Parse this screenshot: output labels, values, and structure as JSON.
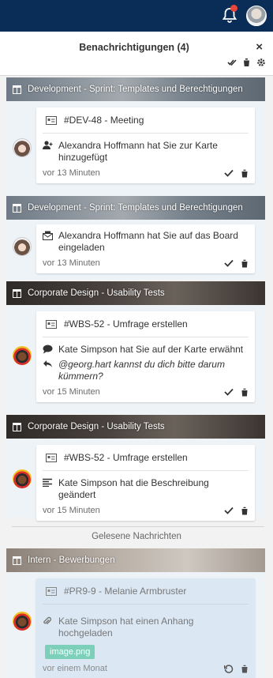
{
  "panel": {
    "title": "Benachrichtigungen (4)",
    "close": "×"
  },
  "groups": [
    {
      "board": "Development - Sprint: Templates und Berechtigungen",
      "card_title": "#DEV-48 - Meeting",
      "message": "Alexandra Hoffmann hat Sie zur Karte hinzugefügt",
      "time": "vor 13 Minuten"
    },
    {
      "board": "Development - Sprint: Templates und Berechtigungen",
      "message": "Alexandra Hoffmann hat Sie auf das Board eingeladen",
      "time": "vor 13 Minuten"
    },
    {
      "board": "Corporate Design - Usability Tests",
      "card_title": "#WBS-52 - Umfrage erstellen",
      "message": "Kate Simpson hat Sie auf der Karte erwähnt",
      "quote": "@georg.hart kannst du dich bitte darum kümmern?",
      "time": "vor 15 Minuten"
    },
    {
      "board": "Corporate Design - Usability Tests",
      "card_title": "#WBS-52 - Umfrage erstellen",
      "message": "Kate Simpson hat die Beschreibung geändert",
      "time": "vor 15 Minuten"
    }
  ],
  "read_section": {
    "label": "Gelesene Nachrichten"
  },
  "read_groups": [
    {
      "board": "Intern - Bewerbungen",
      "card_title": "#PR9-9 - Melanie Armbruster",
      "message": "Kate Simpson hat einen Anhang hochgeladen",
      "attachment": "image.png",
      "time": "vor einem Monat"
    }
  ],
  "colors": {
    "topbar": "#0a2d58",
    "accent_red": "#e6463c",
    "attachment": "#7ccfb8"
  }
}
